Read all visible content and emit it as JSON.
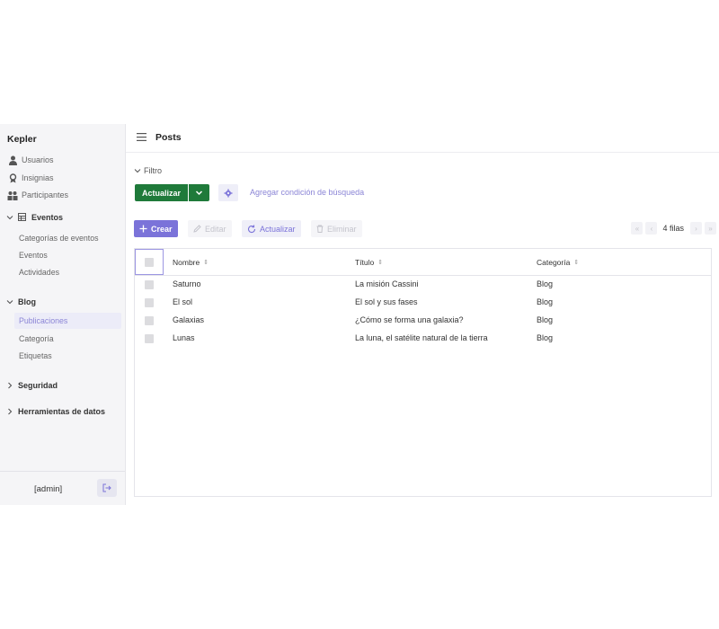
{
  "sidebar": {
    "brand": "Kepler",
    "items": [
      {
        "label": "Usuarios",
        "icon": "user-icon"
      },
      {
        "label": "Insignias",
        "icon": "badge-icon"
      },
      {
        "label": "Participantes",
        "icon": "group-icon"
      }
    ],
    "groups": {
      "eventos": {
        "label": "Eventos",
        "icon": "table-icon",
        "items": [
          "Categorías de eventos",
          "Eventos",
          "Actividades"
        ]
      },
      "blog": {
        "label": "Blog",
        "items": [
          "Publicaciones",
          "Categoría",
          "Etiquetas"
        ]
      },
      "seguridad": {
        "label": "Seguridad"
      },
      "herramientas": {
        "label": "Herramientas de datos"
      }
    },
    "user": "[admin]"
  },
  "header": {
    "title": "Posts"
  },
  "filter": {
    "toggle_label": "Filtro",
    "refresh_label": "Actualizar",
    "add_condition": "Agregar condición de búsqueda"
  },
  "toolbar": {
    "create": "Crear",
    "edit": "Editar",
    "refresh": "Actualizar",
    "delete": "Eliminar",
    "row_count": "4 filas"
  },
  "table": {
    "columns": [
      "Nombre",
      "Título",
      "Categoría"
    ],
    "rows": [
      {
        "nombre": "Saturno",
        "titulo": "La misión Cassini",
        "categoria": "Blog"
      },
      {
        "nombre": "El sol",
        "titulo": "El sol y sus fases",
        "categoria": "Blog"
      },
      {
        "nombre": "Galaxias",
        "titulo": "¿Cómo se forma una galaxia?",
        "categoria": "Blog"
      },
      {
        "nombre": "Lunas",
        "titulo": "La luna, el satélite natural de la tierra",
        "categoria": "Blog"
      }
    ]
  },
  "colors": {
    "accent": "#7b73d9",
    "green": "#1f7a3a",
    "active_bg": "#ececf8"
  }
}
